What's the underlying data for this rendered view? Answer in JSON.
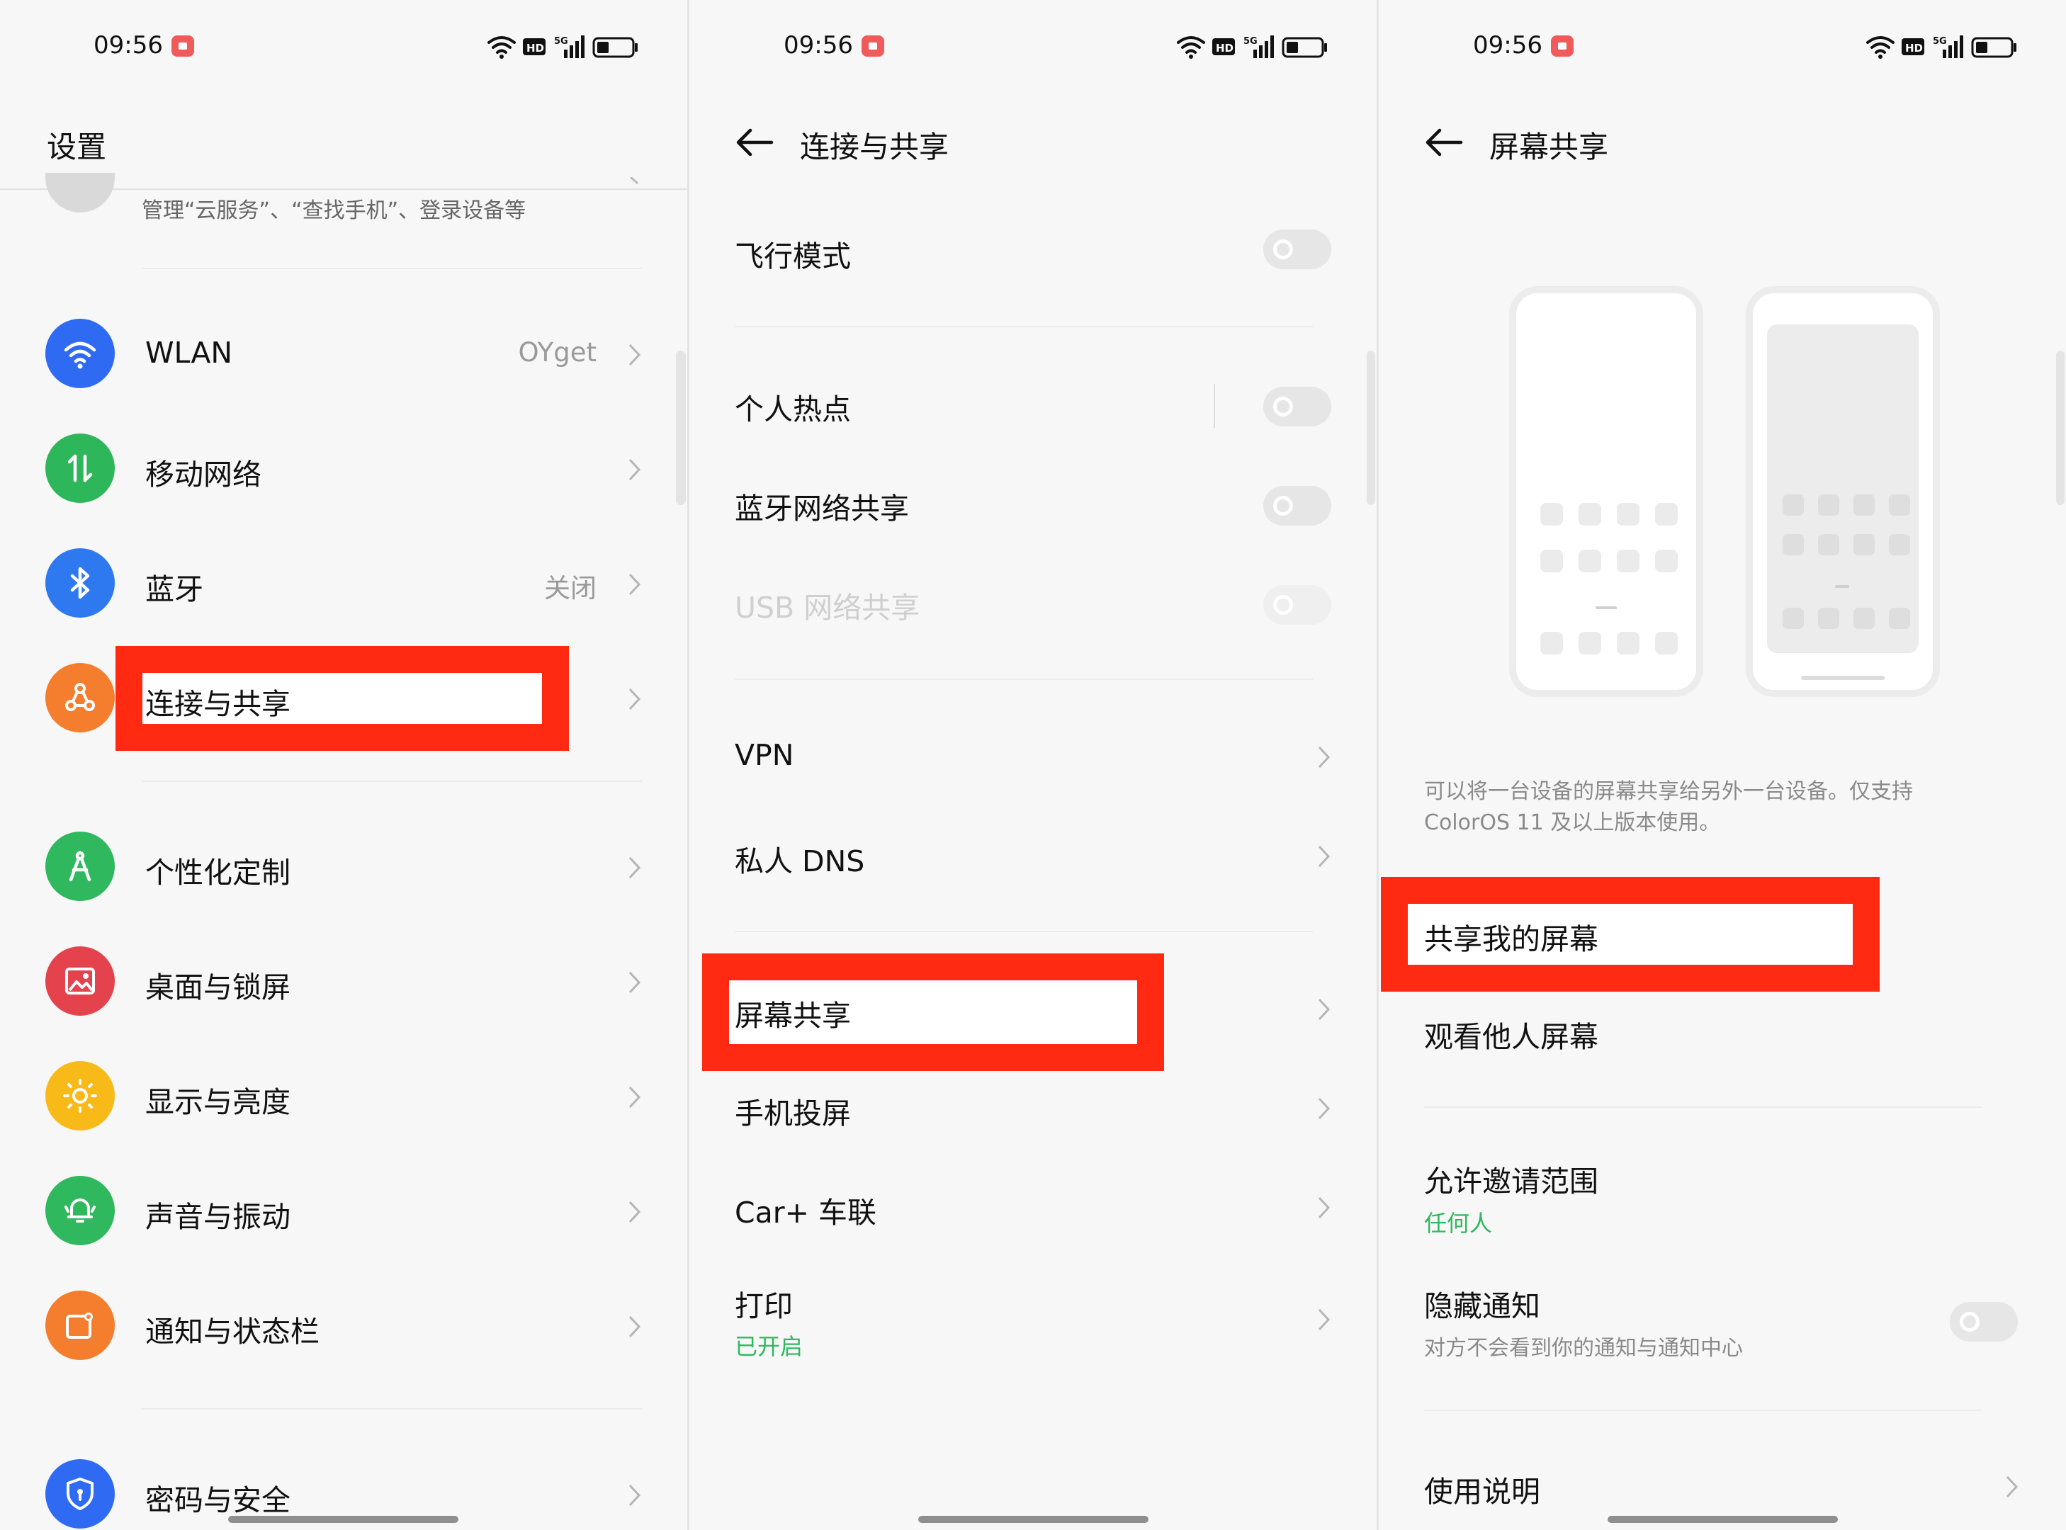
{
  "status": {
    "time": "09:56"
  },
  "panel1": {
    "title": "设置",
    "account_sub": "管理“云服务”、“查找手机”、登录设备等",
    "items": [
      {
        "label": "WLAN",
        "value": "OYget",
        "icon": "wifi-icon",
        "color": "#2f6bf2"
      },
      {
        "label": "移动网络",
        "value": "",
        "icon": "mobile-data-icon",
        "color": "#2eb75a"
      },
      {
        "label": "蓝牙",
        "value": "关闭",
        "icon": "bluetooth-icon",
        "color": "#2f79f0"
      },
      {
        "label": "连接与共享",
        "value": "",
        "icon": "share-connect-icon",
        "color": "#f57d2e"
      },
      {
        "label": "个性化定制",
        "value": "",
        "icon": "personalize-icon",
        "color": "#2fb85e"
      },
      {
        "label": "桌面与锁屏",
        "value": "",
        "icon": "wallpaper-icon",
        "color": "#e4424d"
      },
      {
        "label": "显示与亮度",
        "value": "",
        "icon": "brightness-icon",
        "color": "#f8ba18"
      },
      {
        "label": "声音与振动",
        "value": "",
        "icon": "bell-icon",
        "color": "#2fb85e"
      },
      {
        "label": "通知与状态栏",
        "value": "",
        "icon": "notification-icon",
        "color": "#f57d2e"
      },
      {
        "label": "密码与安全",
        "value": "",
        "icon": "shield-icon",
        "color": "#2f6bf2"
      }
    ]
  },
  "panel2": {
    "title": "连接与共享",
    "airplane": "飞行模式",
    "hotspot": "个人热点",
    "bt_tether": "蓝牙网络共享",
    "usb_tether": "USB 网络共享",
    "vpn": "VPN",
    "dns": "私人 DNS",
    "screen_share": "屏幕共享",
    "cast": "手机投屏",
    "carplus": "Car+ 车联",
    "print": "打印",
    "print_status": "已开启",
    "accent": "#2fb85e"
  },
  "panel3": {
    "title": "屏幕共享",
    "desc": "可以将一台设备的屏幕共享给另外一台设备。仅支持 ColorOS 11 及以上版本使用。",
    "share_mine": "共享我的屏幕",
    "watch_other": "观看他人屏幕",
    "invite_scope": "允许邀请范围",
    "invite_value": "任何人",
    "hide_notif": "隐藏通知",
    "hide_notif_sub": "对方不会看到你的通知与通知中心",
    "instructions": "使用说明"
  },
  "highlight_color": "#ff2a11"
}
